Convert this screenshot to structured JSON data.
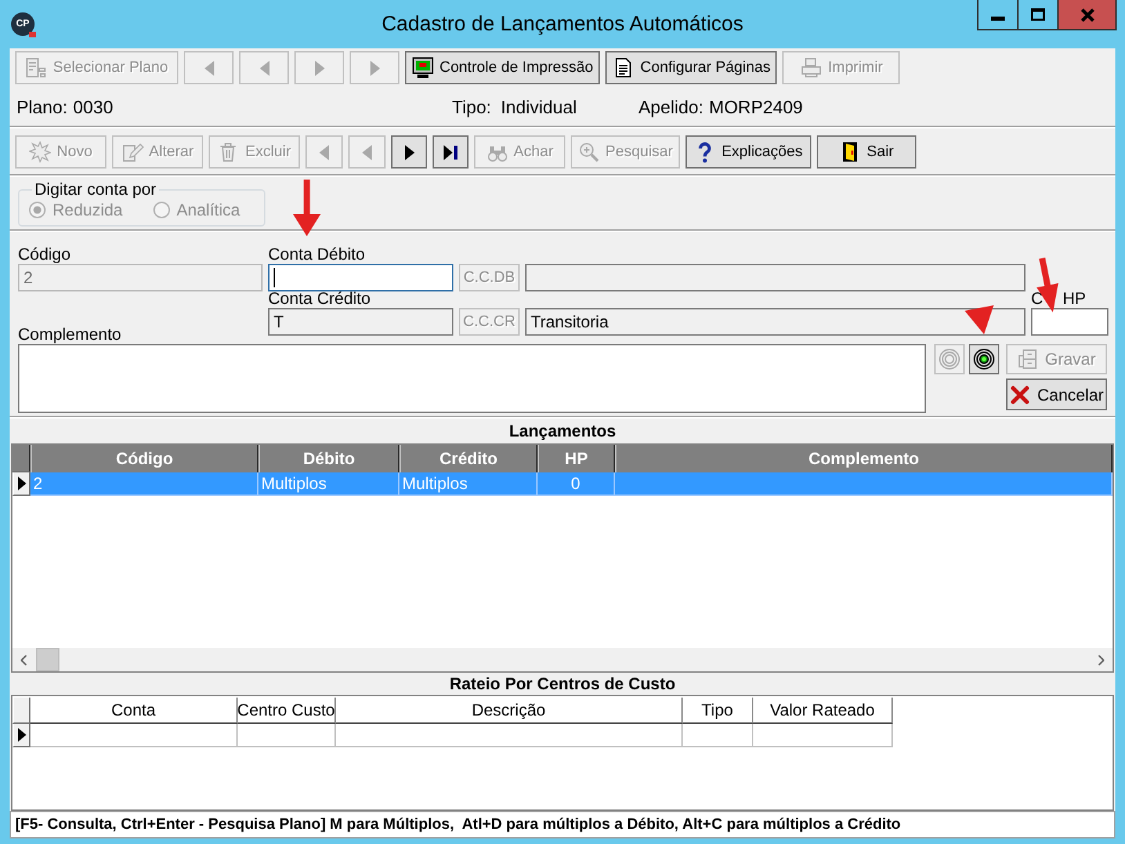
{
  "window": {
    "icon_text": "CP",
    "title": "Cadastro de Lançamentos Automáticos",
    "controls": [
      {
        "kind": "minimize"
      },
      {
        "kind": "maximize"
      },
      {
        "kind": "close"
      }
    ]
  },
  "top_toolbar": [
    {
      "kind": "select-plan",
      "label": "Selecionar Plano",
      "disabled": true
    },
    {
      "kind": "nav-left",
      "disabled": true
    },
    {
      "kind": "nav-left",
      "disabled": true
    },
    {
      "kind": "nav-right",
      "disabled": true
    },
    {
      "kind": "nav-right",
      "disabled": true
    },
    {
      "kind": "print-control",
      "label": "Controle de Impressão",
      "disabled": false
    },
    {
      "kind": "page-setup",
      "label": "Configurar Páginas",
      "disabled": false
    },
    {
      "kind": "print",
      "label": "Imprimir",
      "disabled": true
    }
  ],
  "info": [
    {
      "label": "Plano:",
      "value": "0030"
    },
    {
      "label": "Tipo:",
      "value": "Individual"
    },
    {
      "label": "Apelido:",
      "value": "MORP2409"
    }
  ],
  "record_toolbar": [
    {
      "kind": "new",
      "label": "Novo",
      "disabled": true
    },
    {
      "kind": "edit",
      "label": "Alterar",
      "disabled": true
    },
    {
      "kind": "delete",
      "label": "Excluir",
      "disabled": true
    },
    {
      "kind": "nav-left",
      "disabled": true
    },
    {
      "kind": "nav-left",
      "disabled": true
    },
    {
      "kind": "nav-right",
      "disabled": false
    },
    {
      "kind": "nav-last",
      "disabled": false
    },
    {
      "kind": "find",
      "label": "Achar",
      "disabled": true
    },
    {
      "kind": "search",
      "label": "Pesquisar",
      "disabled": true
    },
    {
      "kind": "help",
      "label": "Explicações",
      "disabled": false
    },
    {
      "kind": "exit",
      "label": "Sair",
      "disabled": false
    }
  ],
  "entry_mode": {
    "title": "Digitar conta por",
    "options": [
      {
        "label": "Reduzida",
        "selected": true,
        "disabled": true
      },
      {
        "label": "Analítica",
        "selected": false,
        "disabled": true
      }
    ]
  },
  "form": {
    "code": {
      "label": "Código",
      "value": "2",
      "disabled": true,
      "readonly": false
    },
    "debit": {
      "label": "Conta Débito",
      "disabled": false,
      "readonly": false,
      "focused": true,
      "lookup": {
        "label": "C.C.DB",
        "disabled": true
      },
      "description": {
        "disabled": false,
        "readonly": true
      }
    },
    "credit": {
      "label": "Conta Crédito",
      "value": "T",
      "disabled": false,
      "readonly": true,
      "focused": false,
      "lookup": {
        "label": "C.C.CR",
        "disabled": true
      },
      "description": {
        "value": "Transitoria",
        "disabled": false,
        "readonly": true
      }
    },
    "hp": {
      "label": "C HP",
      "disabled": false,
      "readonly": false
    },
    "complement": {
      "label": "Complemento",
      "disabled": false,
      "readonly": false
    },
    "targets": [
      {
        "disabled": true
      },
      {
        "disabled": false
      }
    ],
    "actions": [
      {
        "kind": "save",
        "label": "Gravar",
        "disabled": true
      },
      {
        "kind": "cancel",
        "label": "Cancelar",
        "disabled": false
      }
    ]
  },
  "entries": {
    "title": "Lançamentos",
    "columns": [
      {
        "label": "Código",
        "kind": "text"
      },
      {
        "label": "Débito",
        "kind": "text"
      },
      {
        "label": "Crédito",
        "kind": "text"
      },
      {
        "label": "HP",
        "kind": "number"
      },
      {
        "label": "Complemento",
        "kind": "text"
      }
    ],
    "rows": [
      {
        "cells": [
          "2",
          "Multiplos",
          "Multiplos",
          "0"
        ],
        "selected": true,
        "current": true
      }
    ]
  },
  "cost_split": {
    "title": "Rateio Por Centros de Custo",
    "columns": [
      {
        "label": "Conta"
      },
      {
        "label": "Centro Custo"
      },
      {
        "label": "Descrição"
      },
      {
        "label": "Tipo"
      },
      {
        "label": "Valor Rateado"
      }
    ],
    "rows": [
      {
        "selected": false,
        "current": true
      }
    ]
  },
  "status_bar": {
    "text": "[F5- Consulta, Ctrl+Enter - Pesquisa Plano] M para Múltiplos,  Atl+D para múltiplos a Débito, Alt+C para múltiplos a Crédito"
  }
}
